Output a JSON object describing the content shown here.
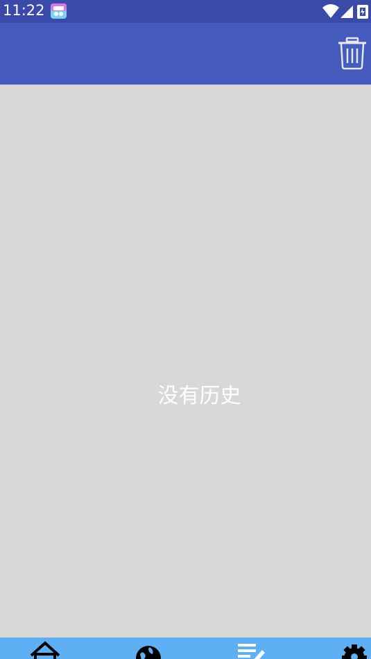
{
  "status_bar": {
    "time": "11:22",
    "icons": [
      "app-icon",
      "wifi-icon",
      "cellular-signal-icon",
      "battery-icon"
    ]
  },
  "app_bar": {
    "actions": [
      {
        "icon": "trash-icon"
      }
    ]
  },
  "content": {
    "empty_message": "没有历史"
  },
  "bottom_nav": {
    "items": [
      {
        "icon": "home-icon"
      },
      {
        "icon": "globe-icon"
      },
      {
        "icon": "notes-edit-icon",
        "selected": true
      },
      {
        "icon": "gear-icon"
      }
    ]
  },
  "colors": {
    "status_bar": "#3a4aa9",
    "app_bar": "#455bbe",
    "background": "#d8d8d8",
    "bottom_nav": "#5eaff3",
    "text_on_dark": "#ffffff"
  }
}
